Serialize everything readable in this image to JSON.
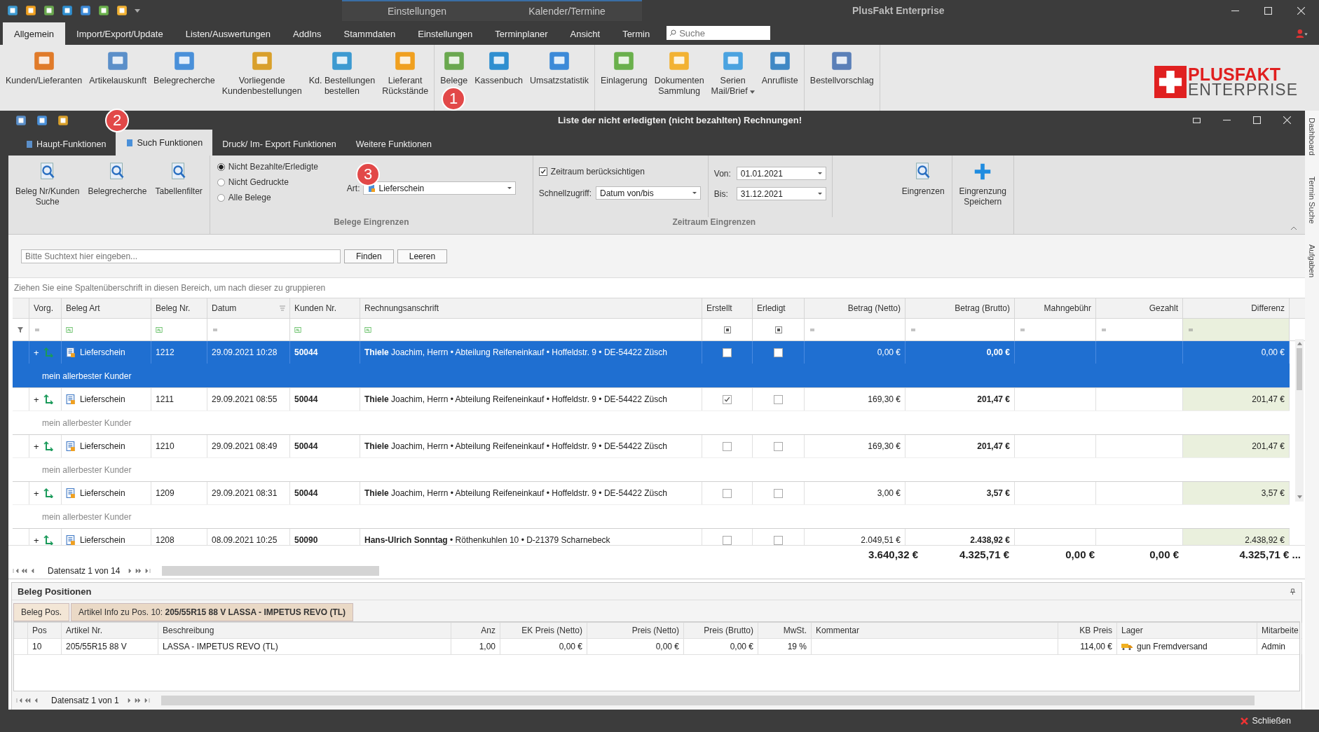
{
  "app": {
    "title": "PlusFakt Enterprise",
    "context_tabs": [
      "Einstellungen",
      "Kalender/Termine"
    ]
  },
  "ribbon_tabs": [
    {
      "label": "Allgemein",
      "selected": true
    },
    {
      "label": "Import/Export/Update",
      "selected": false
    },
    {
      "label": "Listen/Auswertungen",
      "selected": false
    },
    {
      "label": "AddIns",
      "selected": false
    },
    {
      "label": "Stammdaten",
      "selected": false
    },
    {
      "label": "Einstellungen",
      "selected": false
    },
    {
      "label": "Terminplaner",
      "selected": false
    },
    {
      "label": "Ansicht",
      "selected": false
    },
    {
      "label": "Termin",
      "selected": false
    }
  ],
  "search": {
    "placeholder": "Suche"
  },
  "ribbon_groups": [
    {
      "buttons": [
        {
          "label": "Kunden/Lieferanten"
        },
        {
          "label": "Artikelauskunft"
        },
        {
          "label": "Belegrecherche"
        },
        {
          "label": "Vorliegende\nKundenbestellungen"
        },
        {
          "label": "Kd. Bestellungen\nbestellen"
        },
        {
          "label": "Lieferant\nRückstände"
        }
      ]
    },
    {
      "buttons": [
        {
          "label": "Belege"
        },
        {
          "label": "Kassenbuch"
        },
        {
          "label": "Umsatzstatistik"
        }
      ]
    },
    {
      "buttons": [
        {
          "label": "Einlagerung"
        },
        {
          "label": "Dokumenten\nSammlung"
        },
        {
          "label": "Serien\nMail/Brief",
          "dropdown": true
        },
        {
          "label": "Anrufliste"
        }
      ]
    },
    {
      "buttons": [
        {
          "label": "Bestellvorschlag"
        }
      ]
    }
  ],
  "logo": {
    "top": "PLUSFAKT",
    "bottom": "ENTERPRISE"
  },
  "badges": [
    "1",
    "2",
    "3"
  ],
  "window": {
    "title": "Liste der nicht erledigten (nicht bezahlten) Rechnungen!"
  },
  "window_tabs": [
    {
      "label": "Haupt-Funktionen",
      "selected": false
    },
    {
      "label": "Such Funktionen",
      "selected": true
    },
    {
      "label": "Druck/ Im- Export Funktionen",
      "selected": false
    },
    {
      "label": "Weitere Funktionen",
      "selected": false
    }
  ],
  "tool_buttons": [
    {
      "label": "Beleg Nr/Kunden\nSuche"
    },
    {
      "label": "Belegrecherche"
    },
    {
      "label": "Tabellenfilter"
    }
  ],
  "beleg_filter": {
    "options": [
      {
        "label": "Nicht Bezahlte/Erledigte",
        "selected": true
      },
      {
        "label": "Nicht Gedruckte",
        "selected": false
      },
      {
        "label": "Alle Belege",
        "selected": false
      }
    ],
    "art_label": "Art:",
    "art_value": "Lieferschein",
    "group_label": "Belege Eingrenzen"
  },
  "zeitraum": {
    "checkbox_label": "Zeitraum berücksichtigen",
    "checked": true,
    "quick_label": "Schnellzugriff:",
    "quick_value": "Datum von/bis",
    "from_label": "Von:",
    "from_value": "01.01.2021",
    "to_label": "Bis:",
    "to_value": "31.12.2021",
    "group_label": "Zeitraum Eingrenzen"
  },
  "action_buttons": [
    {
      "label": "Eingrenzen",
      "kind": "search"
    },
    {
      "label": "Eingrenzung\nSpeichern",
      "kind": "add"
    }
  ],
  "search_bar": {
    "placeholder": "Bitte Suchtext hier eingeben...",
    "buttons": [
      "Finden",
      "Leeren"
    ]
  },
  "group_hint": "Ziehen Sie eine Spaltenüberschrift in diesen Bereich, um nach dieser zu gruppieren",
  "table": {
    "columns": [
      "Vorg.",
      "Beleg Art",
      "Beleg Nr.",
      "Datum",
      "Kunden Nr.",
      "Rechnungsanschrift",
      "Erstellt",
      "Erledigt",
      "Betrag (Netto)",
      "Betrag (Brutto)",
      "Mahngebühr",
      "Gezahlt",
      "Differenz"
    ],
    "rows": [
      {
        "selected": true,
        "expand": "+",
        "type": "Lieferschein",
        "number": "1212",
        "date": "29.09.2021 10:28",
        "customer": "50044",
        "address": "**Thiele** Joachim, Herrn • Abteilung Reifeneinkauf • Hoffeldstr. 9 • DE-54422 Züsch",
        "created": false,
        "done": false,
        "net": "0,00 €",
        "gross": "0,00 €",
        "difference": "0,00 €",
        "note": "mein allerbester Kunder"
      },
      {
        "selected": false,
        "expand": "+",
        "type": "Lieferschein",
        "number": "1211",
        "date": "29.09.2021 08:55",
        "customer": "50044",
        "address": "**Thiele** Joachim, Herrn • Abteilung Reifeneinkauf • Hoffeldstr. 9 • DE-54422 Züsch",
        "created": true,
        "done": false,
        "net": "169,30 €",
        "gross": "201,47 €",
        "difference": "201,47 €",
        "note": "mein allerbester Kunder"
      },
      {
        "selected": false,
        "expand": "+",
        "type": "Lieferschein",
        "number": "1210",
        "date": "29.09.2021 08:49",
        "customer": "50044",
        "address": "**Thiele** Joachim, Herrn • Abteilung Reifeneinkauf • Hoffeldstr. 9 • DE-54422 Züsch",
        "created": false,
        "done": false,
        "net": "169,30 €",
        "gross": "201,47 €",
        "difference": "201,47 €",
        "note": "mein allerbester Kunder"
      },
      {
        "selected": false,
        "expand": "+",
        "type": "Lieferschein",
        "number": "1209",
        "date": "29.09.2021 08:31",
        "customer": "50044",
        "address": "**Thiele** Joachim, Herrn • Abteilung Reifeneinkauf • Hoffeldstr. 9 • DE-54422 Züsch",
        "created": false,
        "done": false,
        "net": "3,00 €",
        "gross": "3,57 €",
        "difference": "3,57 €",
        "note": "mein allerbester Kunder"
      },
      {
        "selected": false,
        "expand": "+",
        "type": "Lieferschein",
        "number": "1208",
        "date": "08.09.2021 10:25",
        "customer": "50090",
        "address": "**Hans-Ulrich Sonntag** • Röthenkuhlen 10 • D-21379 Scharnebeck",
        "created": false,
        "done": false,
        "net": "2.049,51 €",
        "gross": "2.438,92 €",
        "difference": "2.438,92 €"
      }
    ],
    "totals": [
      "3.640,32 €",
      "4.325,71 €",
      "0,00 €",
      "0,00 €",
      "4.325,71 € ..."
    ]
  },
  "navigator": "Datensatz 1 von 14",
  "positions": {
    "title": "Beleg Positionen",
    "tabs": [
      {
        "label": "Beleg Pos.",
        "selected": true
      },
      {
        "label": "Artikel Info zu Pos. 10: **205/55R15 88 V LASSA - IMPETUS REVO (TL)**",
        "selected": false
      }
    ],
    "columns": [
      "Pos",
      "Artikel Nr.",
      "Beschreibung",
      "Anz",
      "EK Preis (Netto)",
      "Preis (Netto)",
      "Preis (Brutto)",
      "MwSt.",
      "Kommentar",
      "KB Preis",
      "Lager",
      "Mitarbeite"
    ],
    "rows": [
      {
        "cells": [
          "10",
          "205/55R15 88 V",
          "LASSA - IMPETUS REVO (TL)",
          "1,00",
          "0,00 €",
          "0,00 €",
          "0,00 €",
          "19 %",
          "",
          "114,00 €",
          "gun Fremdversand",
          "Admin"
        ]
      }
    ],
    "navigator": "Datensatz 1 von 1"
  },
  "status": {
    "close": "Schließen"
  },
  "side_tabs": [
    "Dashboard",
    "Termin Suche",
    "Aufgaben"
  ]
}
